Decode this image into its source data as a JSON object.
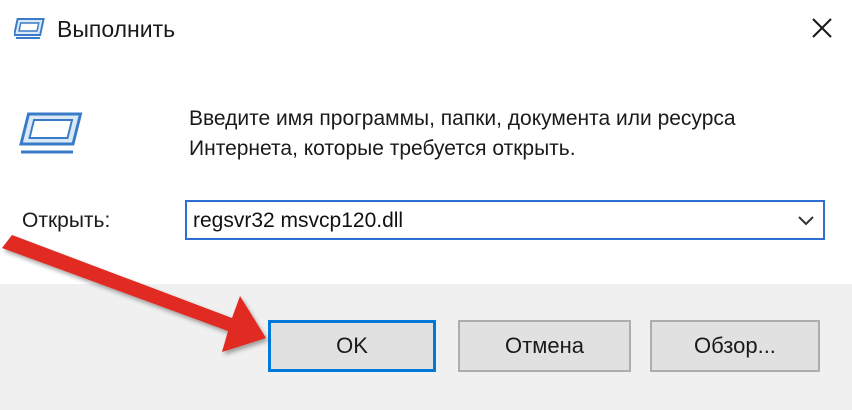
{
  "window": {
    "title": "Выполнить",
    "close_icon": "close-icon"
  },
  "body": {
    "instructions": "Введите имя программы, папки, документа или ресурса Интернета, которые требуется открыть.",
    "open_label": "Открыть:",
    "command_value": "regsvr32 msvcp120.dll",
    "app_icon": "run-dialog-icon",
    "dropdown_icon": "chevron-down-icon"
  },
  "buttons": {
    "ok_label": "OK",
    "cancel_label": "Отмена",
    "browse_label": "Обзор..."
  },
  "annotation": {
    "pointer_icon": "red-arrow-annotation",
    "color": "#e02b20"
  },
  "colors": {
    "focus_border": "#2f6fd2",
    "default_button_border": "#0078d7",
    "footer_bg": "#f0f0f0"
  }
}
